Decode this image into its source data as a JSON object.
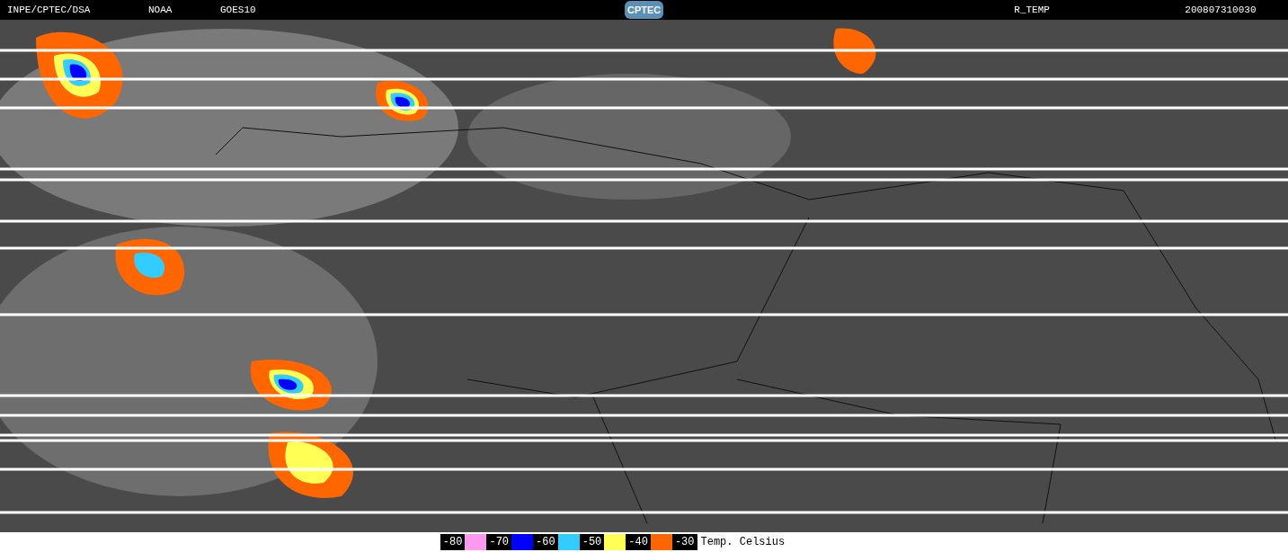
{
  "header": {
    "source": "INPE/CPTEC/DSA",
    "agency": "NOAA",
    "satellite": "GOES10",
    "logo": "CPTEC",
    "product": "R_TEMP",
    "timestamp": "200807310030"
  },
  "legend": {
    "entries": [
      {
        "label": "-80",
        "color": "#ff99f0"
      },
      {
        "label": "-70",
        "color": "#0000ff"
      },
      {
        "label": "-60",
        "color": "#33ccff"
      },
      {
        "label": "-50",
        "color": "#ffff55"
      },
      {
        "label": "-40",
        "color": "#ff6600"
      },
      {
        "label": "-30"
      }
    ],
    "unit": "Temp. Celsius"
  }
}
